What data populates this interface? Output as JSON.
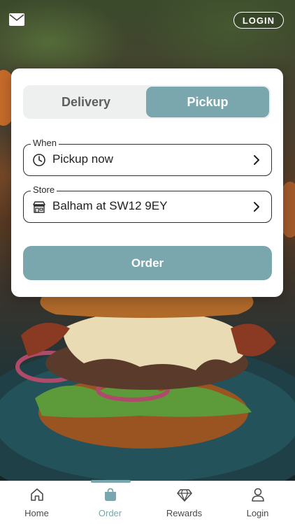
{
  "colors": {
    "accent": "#7aa6ad",
    "card_bg": "#ffffff",
    "text_dark": "#1f1f1f"
  },
  "header": {
    "mail_icon": "mail-icon",
    "login_label": "LOGIN"
  },
  "order_mode": {
    "options": [
      {
        "label": "Delivery",
        "selected": false
      },
      {
        "label": "Pickup",
        "selected": true
      }
    ]
  },
  "when": {
    "legend": "When",
    "value": "Pickup now",
    "icon": "clock-icon"
  },
  "store": {
    "legend": "Store",
    "value": "Balham at SW12 9EY",
    "icon": "store-icon"
  },
  "order_button": "Order",
  "nav": {
    "items": [
      {
        "label": "Home",
        "icon": "home-icon",
        "active": false
      },
      {
        "label": "Order",
        "icon": "bag-icon",
        "active": true
      },
      {
        "label": "Rewards",
        "icon": "diamond-icon",
        "active": false
      },
      {
        "label": "Login",
        "icon": "user-icon",
        "active": false
      }
    ]
  }
}
